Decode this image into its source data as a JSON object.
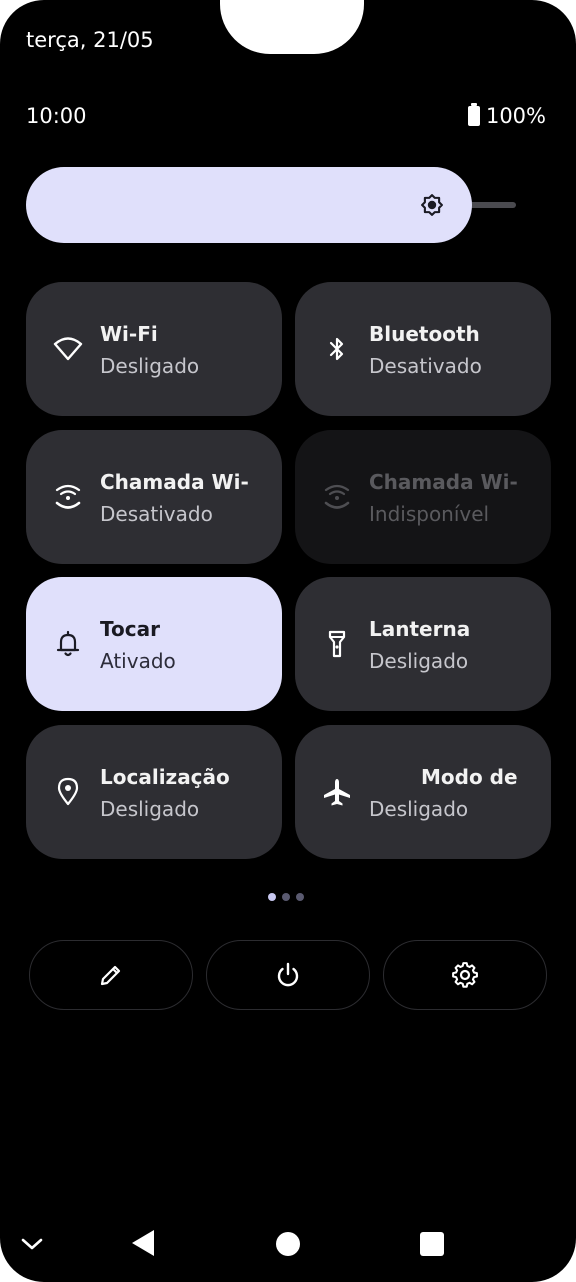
{
  "status": {
    "date": "terça, 21/05",
    "time": "10:00",
    "battery": "100%"
  },
  "brightness": {
    "level": 0.91
  },
  "tiles": [
    {
      "label": "Wi-Fi",
      "sub": "Desligado",
      "icon": "wifi-icon",
      "state": "inactive"
    },
    {
      "label": "Bluetooth",
      "sub": "Desativado",
      "icon": "bluetooth-icon",
      "state": "inactive"
    },
    {
      "label": "Chamada Wi-Fi",
      "sub": "Desativado",
      "icon": "wifi-calling-icon",
      "state": "inactive"
    },
    {
      "label": "Chamada Wi-Fi",
      "sub": "Indisponível",
      "icon": "wifi-calling-icon",
      "state": "disabled"
    },
    {
      "label": "Tocar",
      "sub": "Ativado",
      "icon": "bell-icon",
      "state": "active"
    },
    {
      "label": "Lanterna",
      "sub": "Desligado",
      "icon": "flashlight-icon",
      "state": "inactive"
    },
    {
      "label": "Localização",
      "sub": "Desligado",
      "icon": "location-pin-icon",
      "state": "inactive"
    },
    {
      "label": "Modo de",
      "sub": "Desligado",
      "icon": "airplane-icon",
      "state": "inactive"
    }
  ],
  "pages": {
    "current": 1,
    "total": 3
  },
  "actions": [
    {
      "name": "edit",
      "icon": "pencil-icon"
    },
    {
      "name": "power",
      "icon": "power-icon"
    },
    {
      "name": "settings",
      "icon": "gear-icon"
    }
  ],
  "nav": {
    "icons": [
      "chevron-down-icon",
      "back-icon",
      "home-icon",
      "recents-icon"
    ]
  },
  "colors": {
    "background": "#000000",
    "tile_inactive": "#2e2e33",
    "tile_active": "#e0e0fb",
    "tile_disabled": "#141416"
  }
}
